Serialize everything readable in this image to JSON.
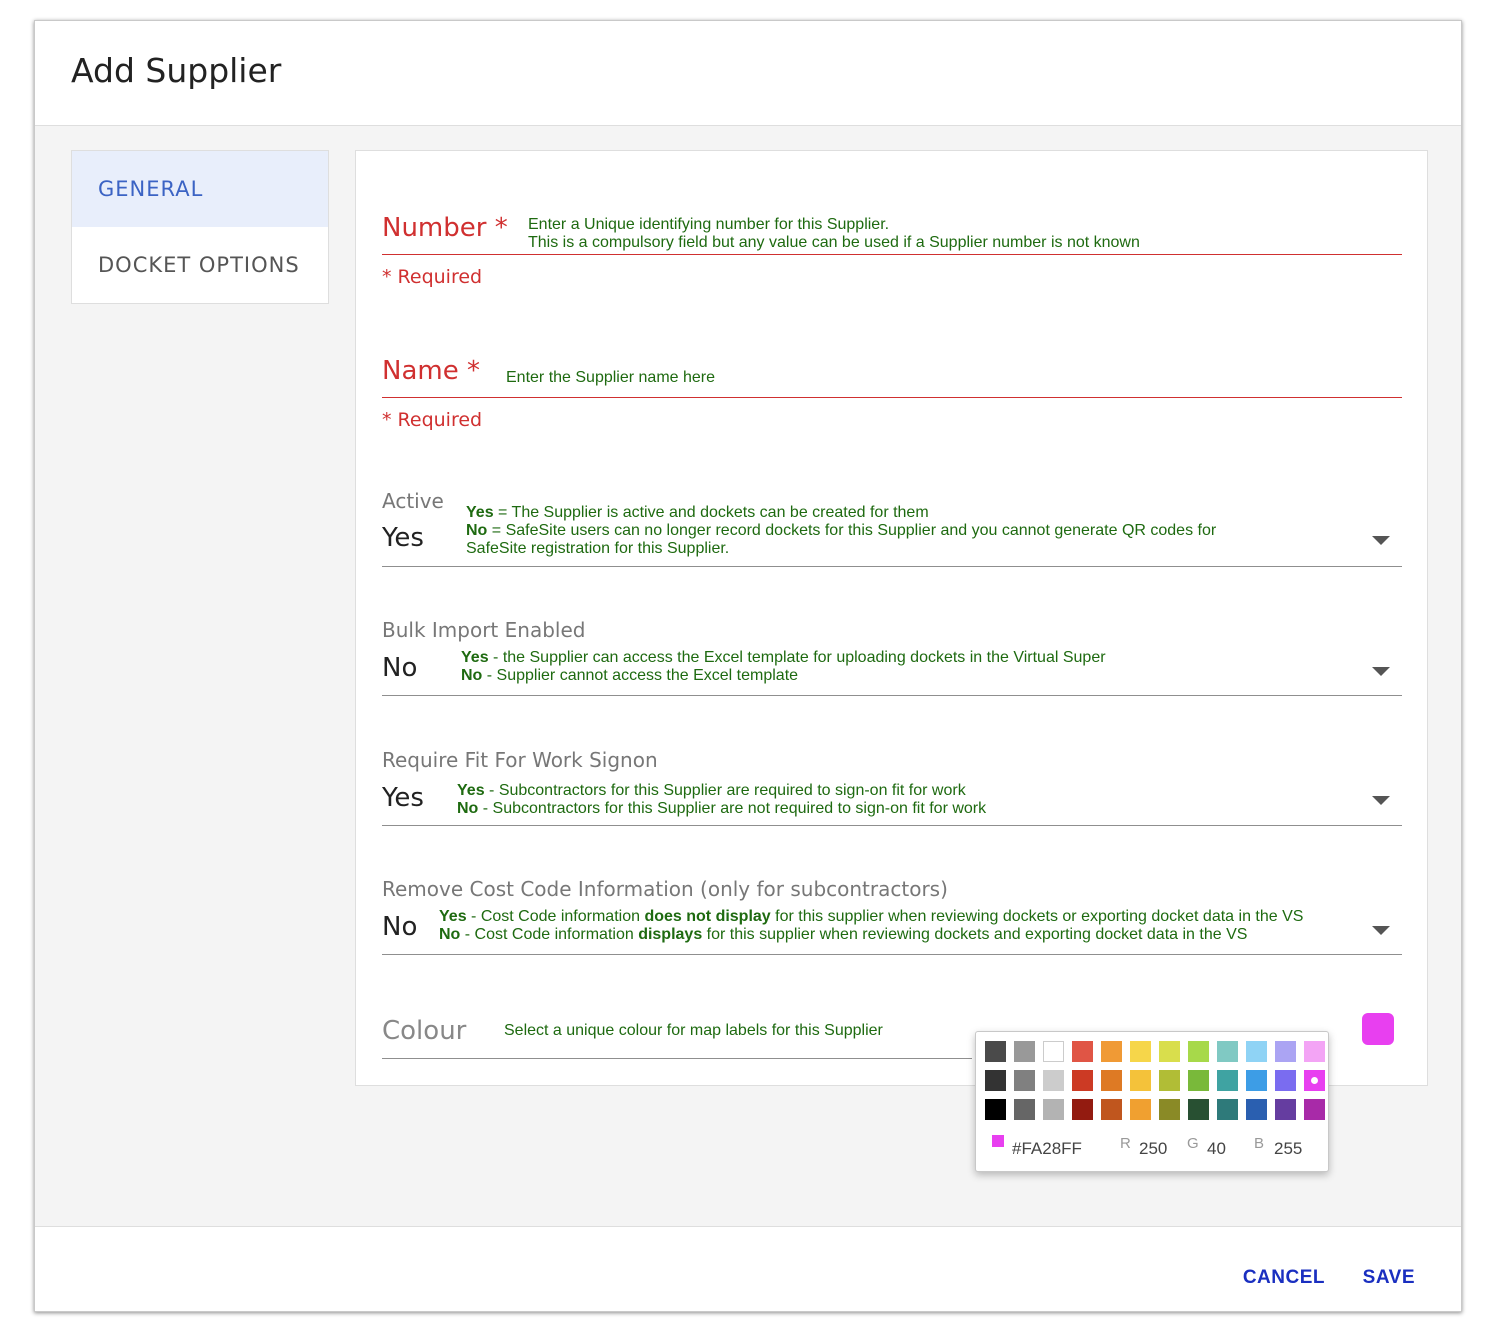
{
  "dialog": {
    "title": "Add Supplier",
    "cancel_label": "CANCEL",
    "save_label": "SAVE"
  },
  "sidebar": {
    "items": [
      {
        "label": "GENERAL",
        "active": true
      },
      {
        "label": "DOCKET OPTIONS",
        "active": false
      }
    ]
  },
  "form": {
    "number": {
      "label": "Number *",
      "error": "* Required",
      "hint_line1": "Enter a Unique identifying number for this Supplier.",
      "hint_line2": "This is a compulsory field but any value can be used if a Supplier number is not known"
    },
    "name": {
      "label": "Name *",
      "error": "* Required",
      "hint": "Enter the Supplier name here"
    },
    "active": {
      "label": "Active",
      "value": "Yes",
      "hint_yes_key": "Yes",
      "hint_yes_text": " = The Supplier is active and dockets can be created for them",
      "hint_no_key": "No",
      "hint_no_text": " = SafeSite users can no longer record dockets for this Supplier and you cannot generate QR codes for",
      "hint_no_text2": "SafeSite registration for this Supplier."
    },
    "bulk_import": {
      "label": "Bulk Import Enabled",
      "value": "No",
      "hint_yes_key": "Yes",
      "hint_yes_text": " - the Supplier can access the Excel template for uploading dockets in the Virtual Super",
      "hint_no_key": "No",
      "hint_no_text": " - Supplier cannot access the Excel template"
    },
    "fit_for_work": {
      "label": "Require Fit For Work Signon",
      "value": "Yes",
      "hint_yes_key": "Yes",
      "hint_yes_text": " - Subcontractors for this Supplier are required to sign-on fit for work",
      "hint_no_key": "No",
      "hint_no_text": " - Subcontractors for this Supplier are not required to sign-on fit for work"
    },
    "cost_code": {
      "label": "Remove Cost Code Information (only for subcontractors)",
      "value": "No",
      "hint_yes_key": "Yes",
      "hint_yes_a": " - Cost Code information ",
      "hint_yes_bold": "does not display",
      "hint_yes_b": " for this supplier when reviewing dockets or exporting docket data in the VS",
      "hint_no_key": "No",
      "hint_no_a": " - Cost Code information ",
      "hint_no_bold": "displays",
      "hint_no_b": " for this supplier when reviewing dockets and exporting docket data in the VS"
    },
    "colour": {
      "label": "Colour",
      "hint": "Select a unique colour for map labels for this Supplier",
      "value": "#E83FF0"
    }
  },
  "picker": {
    "colors": [
      [
        "#4a4a4a",
        "#999999",
        "#ffffff",
        "#e05545",
        "#f09a35",
        "#f6d64a",
        "#d9de4c",
        "#a7d94a",
        "#80c9c3",
        "#8fd3f5",
        "#aba4f3",
        "#f3a4f5"
      ],
      [
        "#333333",
        "#808080",
        "#cccccc",
        "#cc3a24",
        "#de7a24",
        "#f4c23a",
        "#b1bd36",
        "#79b93a",
        "#3fa3a2",
        "#3d9de6",
        "#7a6cf0",
        "#e83ff0"
      ],
      [
        "#000000",
        "#666666",
        "#b3b3b3",
        "#931b10",
        "#c0561e",
        "#f0a030",
        "#8a8a26",
        "#285032",
        "#2e7a7a",
        "#2a5fb0",
        "#653da0",
        "#a82aa8"
      ]
    ],
    "selected": [
      1,
      11
    ],
    "hex": "#FA28FF",
    "r_label": "R",
    "r": "250",
    "g_label": "G",
    "g": "40",
    "b_label": "B",
    "b": "255"
  }
}
